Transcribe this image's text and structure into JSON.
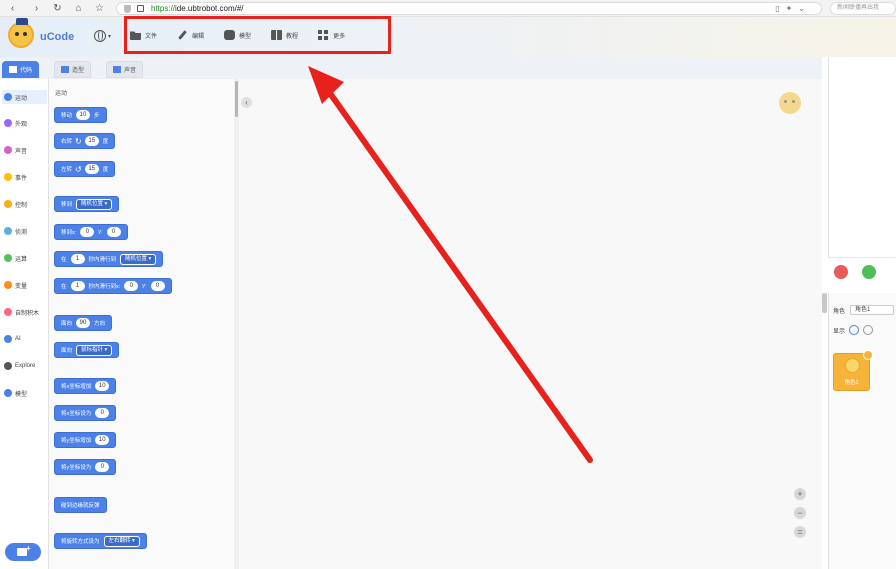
{
  "browser": {
    "url_scheme": "https://",
    "url_rest": "ide.ubtrobot.com/#/",
    "search_placeholder": "新闻联播再出我"
  },
  "app": {
    "name": "uCode",
    "menu": [
      {
        "label": "文件",
        "icon": "folder-icon"
      },
      {
        "label": "编辑",
        "icon": "pen-icon"
      },
      {
        "label": "模型",
        "icon": "puzzle-icon"
      },
      {
        "label": "教程",
        "icon": "books-icon"
      },
      {
        "label": "更多",
        "icon": "grid-icon"
      }
    ]
  },
  "tabs": [
    {
      "label": "代码",
      "active": true
    },
    {
      "label": "造型",
      "active": false
    },
    {
      "label": "声音",
      "active": false
    }
  ],
  "categories": [
    {
      "label": "运动",
      "color": "#4c82e8"
    },
    {
      "label": "外观",
      "color": "#9966ff"
    },
    {
      "label": "声音",
      "color": "#cf63cf"
    },
    {
      "label": "事件",
      "color": "#ffbf00"
    },
    {
      "label": "控制",
      "color": "#ffab19"
    },
    {
      "label": "侦测",
      "color": "#5cb1d6"
    },
    {
      "label": "运算",
      "color": "#59c059"
    },
    {
      "label": "变量",
      "color": "#ff8c1a"
    },
    {
      "label": "自制积木",
      "color": "#ff6680"
    },
    {
      "label": "AI",
      "color": "#4c82e8"
    },
    {
      "label": "Explore",
      "color": "#555555"
    },
    {
      "label": "模型",
      "color": "#4c82e8"
    }
  ],
  "palette": {
    "title": "运动",
    "blocks": [
      {
        "parts": [
          "t:移动",
          "n:10",
          "t:步"
        ]
      },
      {
        "parts": [
          "t:右转",
          "a:↻",
          "n:15",
          "t:度"
        ]
      },
      {
        "parts": [
          "t:左转",
          "a:↺",
          "n:15",
          "t:度"
        ]
      },
      {
        "parts": [
          "t:移到",
          "d:随机位置 ▾"
        ]
      },
      {
        "parts": [
          "t:移到x:",
          "n:0",
          "t:y:",
          "n:0"
        ]
      },
      {
        "parts": [
          "t:在",
          "n:1",
          "t:秒内滑行到",
          "d:随机位置 ▾"
        ]
      },
      {
        "parts": [
          "t:在",
          "n:1",
          "t:秒内滑行到x:",
          "n:0",
          "t:y:",
          "n:0"
        ]
      },
      {
        "parts": [
          "t:面向",
          "n:90",
          "t:方向"
        ]
      },
      {
        "parts": [
          "t:面向",
          "d:鼠标指针 ▾"
        ]
      },
      {
        "parts": [
          "t:将x坐标增加",
          "n:10"
        ]
      },
      {
        "parts": [
          "t:将x坐标设为",
          "n:0"
        ]
      },
      {
        "parts": [
          "t:将y坐标增加",
          "n:10"
        ]
      },
      {
        "parts": [
          "t:将y坐标设为",
          "n:0"
        ]
      },
      {
        "parts": [
          "t:碰到边缘就反弹"
        ]
      },
      {
        "parts": [
          "t:将旋转方式设为",
          "d:左右翻转 ▾"
        ]
      }
    ]
  },
  "workspace": {
    "collapse_symbol": "‹",
    "zoom_in": "+",
    "zoom_out": "−",
    "zoom_reset": "="
  },
  "sprite_panel": {
    "sprite_label": "角色",
    "sprite_name": "角色1",
    "show_label": "显示",
    "card_name": "角色1"
  },
  "colors": {
    "accent": "#4c82e8",
    "highlight_box": "#e8211c",
    "go": "#4cbf56",
    "stop": "#ec5959"
  }
}
